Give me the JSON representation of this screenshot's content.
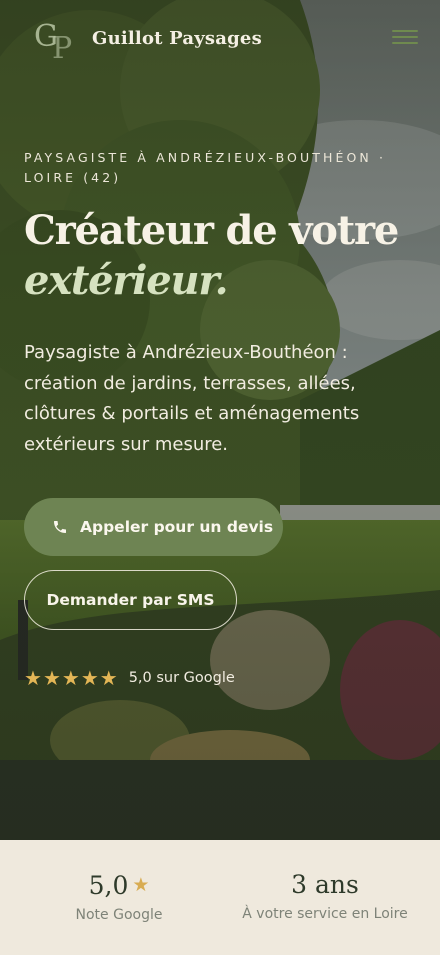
{
  "header": {
    "logo_monogram": "GP",
    "brand": "Guillot Paysages",
    "menu_icon": "hamburger-icon",
    "menu_color": "#6f8a4f"
  },
  "hero": {
    "eyebrow": "Paysagiste à Andrézieux-Bouthéon · Loire (42)",
    "headline_line1": "Créateur de votre",
    "headline_accent": "extérieur.",
    "lead": "Paysagiste à Andrézieux-Bouthéon : création de jardins, terrasses, allées, clôtures & portails et aménagements extérieurs sur mesure.",
    "cta_call": "Appeler pour un devis",
    "cta_call_icon": "phone-icon",
    "cta_sms": "Demander par SMS",
    "rating_stars": 5,
    "rating_text": "5,0 sur Google"
  },
  "stats": [
    {
      "value": "5,0",
      "label": "Note Google",
      "has_star": true
    },
    {
      "value": "3 ans",
      "label": "À votre service en Loire",
      "has_star": false
    }
  ],
  "colors": {
    "accent_green": "#6e8453",
    "star_gold": "#e3b656",
    "headline_accent": "#d6e2c0",
    "stats_bg": "#efe9dd"
  }
}
